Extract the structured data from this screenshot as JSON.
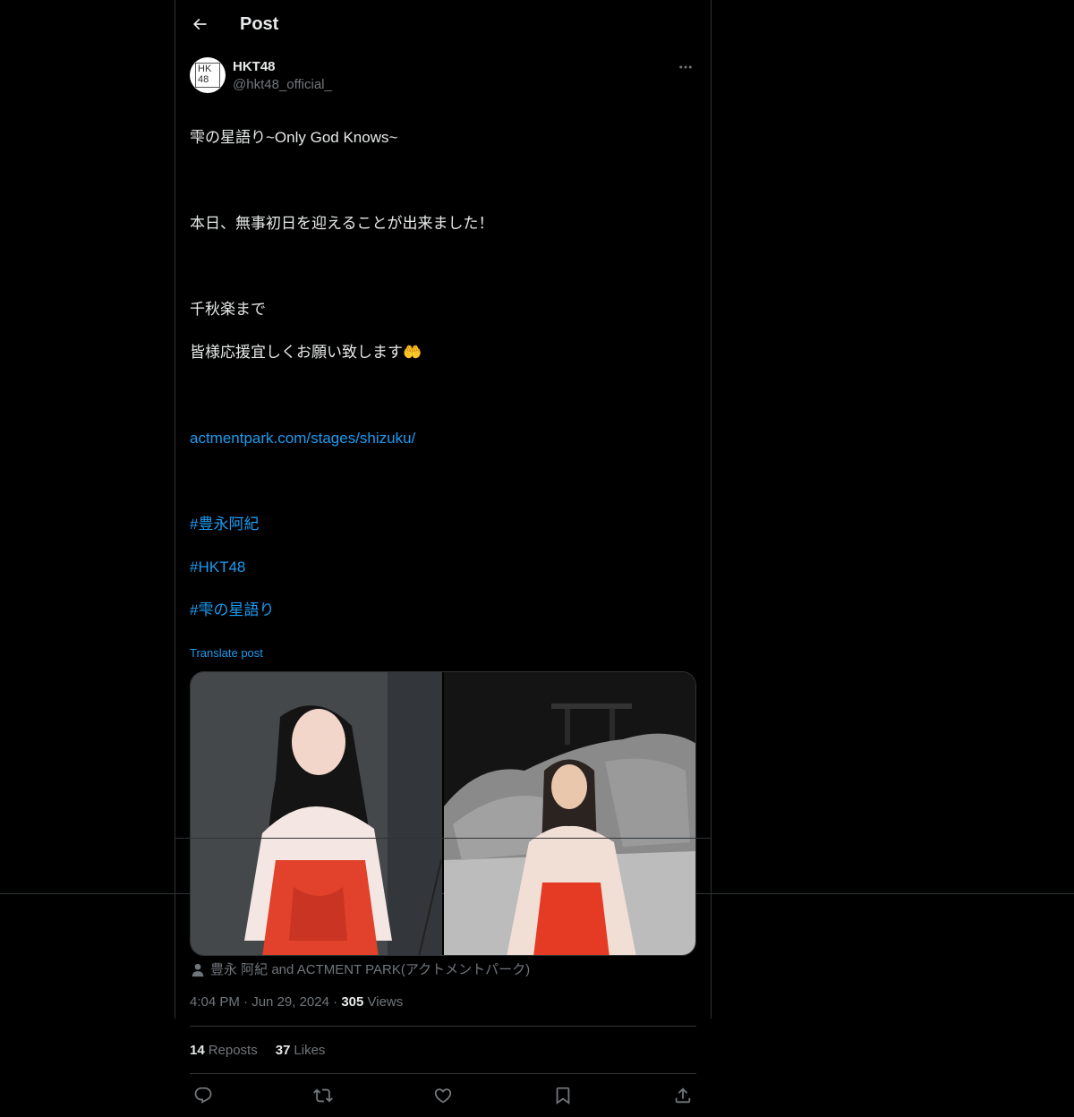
{
  "header": {
    "title": "Post"
  },
  "author": {
    "avatar_text": "HKT48",
    "display_name": "HKT48",
    "handle": "@hkt48_official_"
  },
  "post": {
    "line1": "雫の星語り~Only God Knows~",
    "line2": "本日、無事初日を迎えることが出来ました！",
    "line3": "千秋楽まで",
    "line4": "皆様応援宜しくお願い致します🤲",
    "link": "actmentpark.com/stages/shizuku/",
    "hashtags": [
      "#豊永阿紀",
      "#HKT48",
      "#雫の星語り"
    ],
    "translate": "Translate post"
  },
  "media": {
    "tagged": "豊永 阿紀 and ACTMENT PARK(アクトメントパーク)"
  },
  "meta": {
    "time": "4:04 PM",
    "date": "Jun 29, 2024",
    "views_count": "305",
    "views_label": "Views"
  },
  "stats": {
    "reposts_count": "14",
    "reposts_label": "Reposts",
    "likes_count": "37",
    "likes_label": "Likes"
  },
  "colors": {
    "accent": "#1d9bf0",
    "text_primary": "#e7e9ea",
    "text_secondary": "#71767b",
    "border": "#2f3336"
  },
  "icons": {
    "back": "arrow-left-icon",
    "more": "more-horizontal-icon",
    "reply": "reply-icon",
    "repost": "repost-icon",
    "like": "heart-icon",
    "bookmark": "bookmark-icon",
    "share": "share-icon",
    "tag": "person-icon"
  }
}
